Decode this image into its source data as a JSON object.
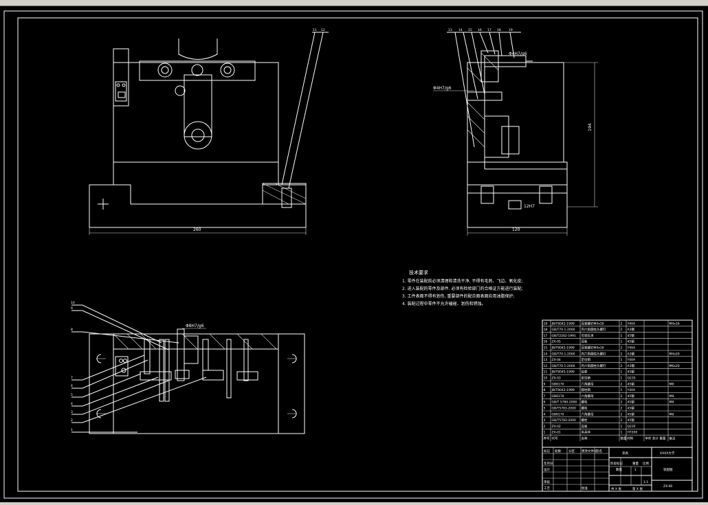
{
  "tech_requirements": {
    "title": "技术要求",
    "items": [
      "1. 零件在装配前必须清理和清洗干净, 不得有毛刺、飞边、氧化皮;",
      "2. 进入装配的零件及部件, 必须有检验部门的合格证方能进行装配;",
      "3. 工件表面不得有划伤, 重要部件的配合面表面应用油脂保护;",
      "4. 装配过程中零件不允许磕碰、划伤和锈蚀。"
    ]
  },
  "front_view": {
    "dim_width": "260",
    "callouts": [
      "11",
      "12"
    ]
  },
  "side_view": {
    "dim_width": "120",
    "dim_height": "194",
    "fit_top": "Φ4H7/g6",
    "fit_left": "Φ4H7/g6",
    "fit_bottom": "12H7",
    "callouts": [
      "13",
      "14",
      "15",
      "16",
      "17",
      "18",
      "19"
    ]
  },
  "plan_view": {
    "fit_top": "Φ8H7/g6",
    "callouts": [
      "10",
      "9",
      "8",
      "7",
      "6",
      "5",
      "4",
      "3",
      "2",
      "1"
    ]
  },
  "bom": {
    "rows": [
      [
        "19",
        "JB/T8042-1999",
        "压紧螺钉M4x16",
        "2",
        "Y40A",
        "",
        "M4x16"
      ],
      [
        "18",
        "GB/T70.1-2000",
        "内六角圆柱头螺钉",
        "2",
        "A3钢",
        "",
        ""
      ],
      [
        "17",
        "GB/T2262-1991",
        "可调支承",
        "1",
        "45钢",
        "",
        ""
      ],
      [
        "16",
        "ZX-05",
        "压板",
        "1",
        "45钢",
        "",
        ""
      ],
      [
        "15",
        "JB/T8042-1999",
        "压紧螺钉M4x16",
        "2",
        "Y40A",
        "",
        ""
      ],
      [
        "14",
        "GB/T70.1-2000",
        "内六角圆柱头螺钉",
        "2",
        "A3钢",
        "",
        "M4x20"
      ],
      [
        "13",
        "ZX-04",
        "定位销",
        "1",
        "Y40A",
        "",
        ""
      ],
      [
        "12",
        "GB/T70.1-2000",
        "内六角圆柱头螺钉",
        "2",
        "A3钢",
        "",
        "M6x20"
      ],
      [
        "11",
        "JB/T8045-1999",
        "钻套",
        "1",
        "45钢",
        "",
        ""
      ],
      [
        "10",
        "ZX-03",
        "定位销",
        "1",
        "Q235",
        "",
        ""
      ],
      [
        "9",
        "GB6170",
        "六角螺母",
        "2",
        "45钢",
        "",
        "M8"
      ],
      [
        "8",
        "JB/T8042-1999",
        "圆柱销",
        "1",
        "Y40A",
        "",
        ""
      ],
      [
        "7",
        "GB6170",
        "六角螺母",
        "2",
        "45钢",
        "",
        "M8"
      ],
      [
        "6",
        "GB/T 5780-2000",
        "螺栓",
        "2",
        "45钢",
        "",
        "M8"
      ],
      [
        "5",
        "GB/T5783-2000",
        "螺栓",
        "2",
        "45钢",
        "",
        ""
      ],
      [
        "4",
        "GB6170",
        "六角螺母",
        "2",
        "45钢",
        "",
        "M8"
      ],
      [
        "3",
        "GB/T5783-2000",
        "螺栓",
        "2",
        "45钢",
        "",
        ""
      ],
      [
        "2",
        "ZX-02",
        "压板",
        "1",
        "Q235",
        "",
        ""
      ],
      [
        "1",
        "ZX-01",
        "夹具体",
        "1",
        "HT200",
        "",
        ""
      ]
    ],
    "headers": [
      "序号",
      "代号",
      "名称",
      "数量",
      "材料",
      "单件 总计 重量",
      "备注"
    ]
  },
  "title_block": {
    "part": "夹具",
    "school": "XXXX大学",
    "qty": "数量",
    "qty_val": "1",
    "drawing_name": "装配图",
    "scale": "1:1",
    "code": "ZX-00",
    "sheet": "共 X 张",
    "sheet2": "第 X 张",
    "labels": [
      "标记",
      "处数",
      "分区",
      "更改文件号",
      "签名",
      "年月日",
      "设计",
      "审核",
      "工艺",
      "批准",
      "阶段标记",
      "重量",
      "比例"
    ]
  }
}
